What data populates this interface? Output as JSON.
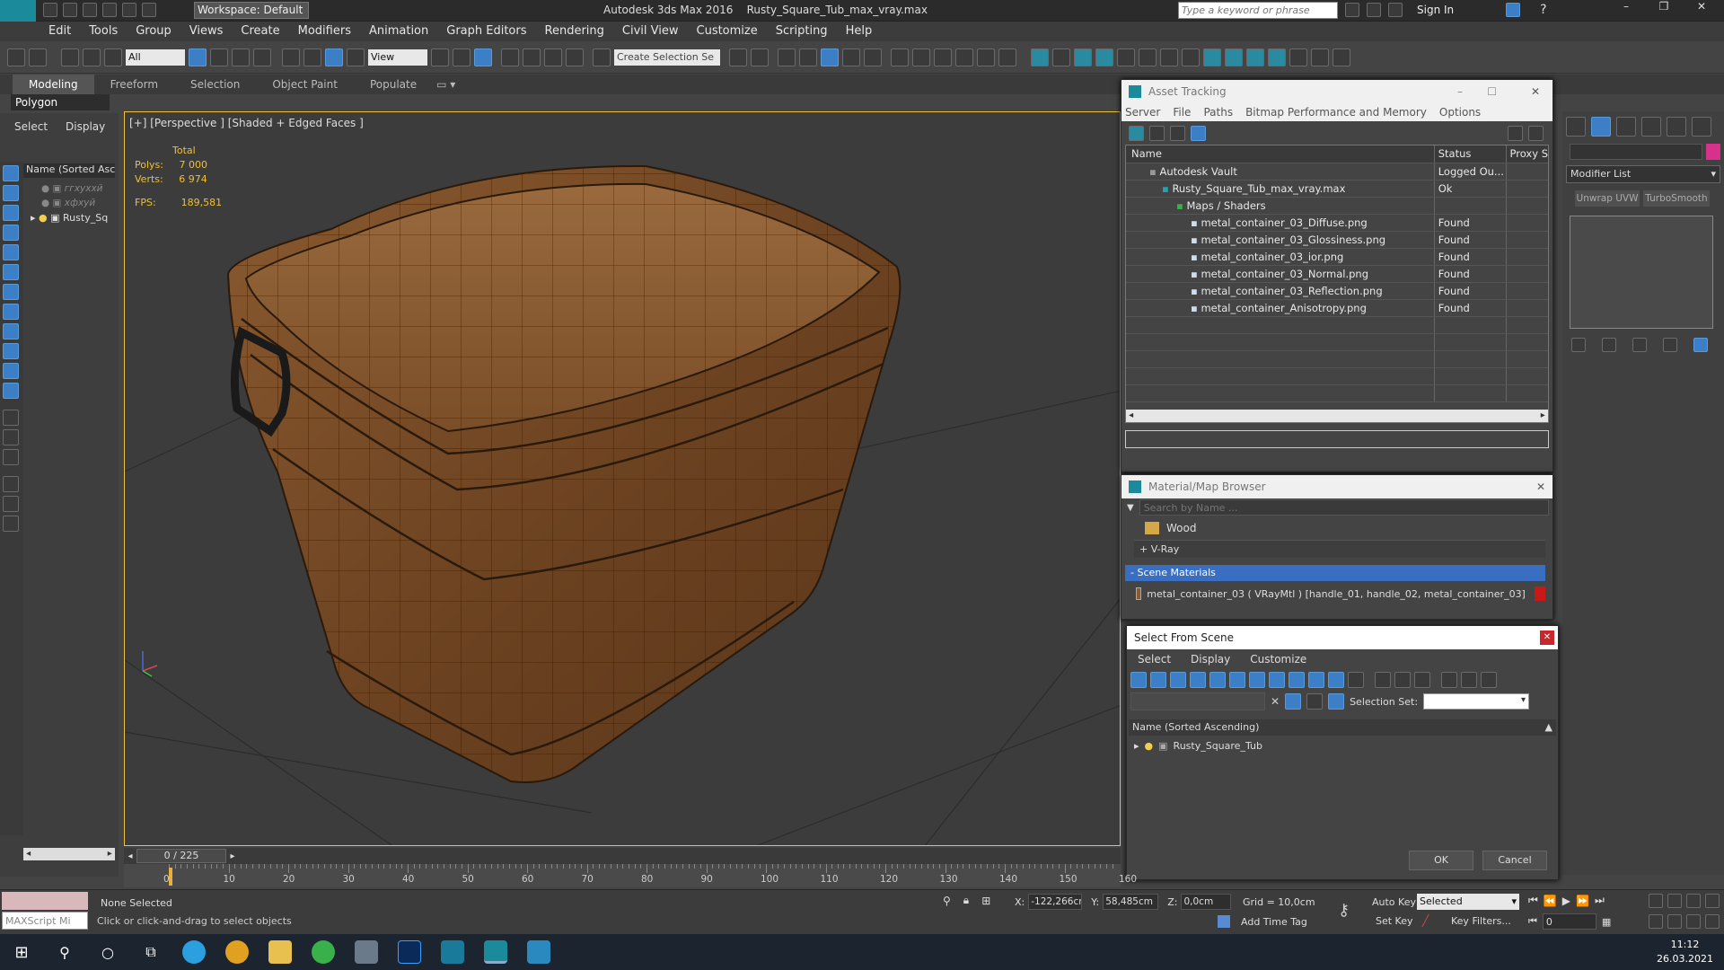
{
  "titlebar": {
    "workspace": "Workspace: Default",
    "app": "Autodesk 3ds Max 2016",
    "file": "Rusty_Square_Tub_max_vray.max",
    "search_placeholder": "Type a keyword or phrase",
    "sign_in": "Sign In"
  },
  "menu": [
    "Edit",
    "Tools",
    "Group",
    "Views",
    "Create",
    "Modifiers",
    "Animation",
    "Graph Editors",
    "Rendering",
    "Civil View",
    "Customize",
    "Scripting",
    "Help"
  ],
  "toolbar": {
    "filter": "All",
    "view": "View",
    "selection_set": "Create Selection Se"
  },
  "ribbon": {
    "tabs": [
      "Modeling",
      "Freeform",
      "Selection",
      "Object Paint",
      "Populate"
    ],
    "sub": "Polygon Modeling"
  },
  "left": {
    "select": "Select",
    "display": "Display",
    "header": "Name (Sorted Ascen",
    "items": [
      "ггхуххй",
      "хфхуй",
      "Rusty_Sq"
    ]
  },
  "viewport": {
    "label": "[+] [Perspective ] [Shaded + Edged Faces ]",
    "total": "Total",
    "polys_label": "Polys:",
    "polys": "7 000",
    "verts_label": "Verts:",
    "verts": "6 974",
    "fps_label": "FPS:",
    "fps": "189,581"
  },
  "asset": {
    "title": "Asset Tracking",
    "menu": [
      "Server",
      "File",
      "Paths",
      "Bitmap Performance and Memory",
      "Options"
    ],
    "cols": [
      "Name",
      "Status",
      "Proxy S"
    ],
    "rows": [
      {
        "name": "Autodesk Vault",
        "status": "Logged Ou..."
      },
      {
        "name": "Rusty_Square_Tub_max_vray.max",
        "status": "Ok"
      },
      {
        "name": "Maps / Shaders",
        "status": ""
      },
      {
        "name": "metal_container_03_Diffuse.png",
        "status": "Found"
      },
      {
        "name": "metal_container_03_Glossiness.png",
        "status": "Found"
      },
      {
        "name": "metal_container_03_ior.png",
        "status": "Found"
      },
      {
        "name": "metal_container_03_Normal.png",
        "status": "Found"
      },
      {
        "name": "metal_container_03_Reflection.png",
        "status": "Found"
      },
      {
        "name": "metal_container_Anisotropy.png",
        "status": "Found"
      }
    ]
  },
  "matbrowser": {
    "title": "Material/Map Browser",
    "search": "Search by Name ...",
    "wood": "Wood",
    "vray": "+ V-Ray",
    "scene": "- Scene Materials",
    "material": "metal_container_03  ( VRayMtl )  [handle_01, handle_02, metal_container_03]"
  },
  "selscene": {
    "title": "Select From Scene",
    "menu": [
      "Select",
      "Display",
      "Customize"
    ],
    "selset": "Selection Set:",
    "header": "Name (Sorted Ascending)",
    "item": "Rusty_Square_Tub",
    "ok": "OK",
    "cancel": "Cancel"
  },
  "rightpanel": {
    "modifier_list": "Modifier List",
    "btn1": "Unwrap UVW",
    "btn2": "TurboSmooth"
  },
  "timeline": {
    "frame": "0 / 225",
    "ticks": [
      "0",
      "10",
      "20",
      "30",
      "40",
      "50",
      "60",
      "70",
      "80",
      "90",
      "100",
      "110",
      "120",
      "130",
      "140",
      "150",
      "160"
    ]
  },
  "status": {
    "maxscript": "MAXScript Mi",
    "none_selected": "None Selected",
    "prompt": "Click or click-and-drag to select objects",
    "x_label": "X:",
    "x": "-122,266cr",
    "y_label": "Y:",
    "y": "58,485cm",
    "z_label": "Z:",
    "z": "0,0cm",
    "grid": "Grid = 10,0cm",
    "add_time_tag": "Add Time Tag",
    "auto_key": "Auto Key",
    "set_key": "Set Key",
    "selected": "Selected",
    "key_filters": "Key Filters...",
    "frame": "0"
  },
  "taskbar": {
    "time": "11:12",
    "date": "26.03.2021"
  }
}
